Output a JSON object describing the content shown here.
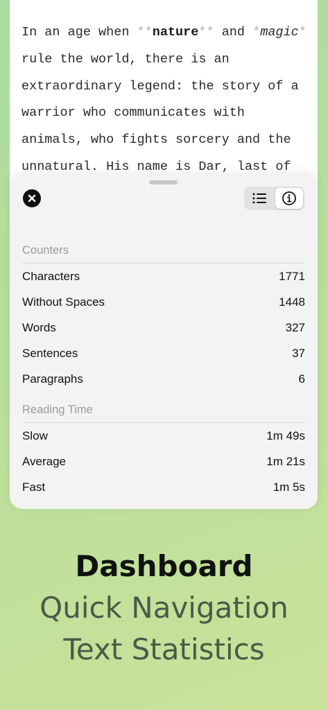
{
  "editor": {
    "seg1": "In an age when ",
    "mark1a": "**",
    "bold": "nature",
    "mark1b": "**",
    "seg2": " and ",
    "mark2a": "*",
    "italic": "magic",
    "mark2b": "*",
    "seg3": "\nrule the world, there is an\nextraordinary legend: the story of a\nwarrior who communicates with\nanimals, who fights sorcery and the\nunnatural. His name is Dar, last of"
  },
  "sheet": {
    "counters": {
      "header": "Counters",
      "rows": [
        {
          "label": "Characters",
          "value": "1771"
        },
        {
          "label": "Without Spaces",
          "value": "1448"
        },
        {
          "label": "Words",
          "value": "327"
        },
        {
          "label": "Sentences",
          "value": "37"
        },
        {
          "label": "Paragraphs",
          "value": "6"
        }
      ]
    },
    "reading_time": {
      "header": "Reading Time",
      "rows": [
        {
          "label": "Slow",
          "value": "1m 49s"
        },
        {
          "label": "Average",
          "value": "1m 21s"
        },
        {
          "label": "Fast",
          "value": "1m 5s"
        }
      ]
    },
    "segmented": {
      "selected": "info",
      "options": [
        "list-icon",
        "info-icon"
      ]
    }
  },
  "caption": {
    "title": "Dashboard",
    "line1": "Quick Navigation",
    "line2": "Text Statistics"
  }
}
